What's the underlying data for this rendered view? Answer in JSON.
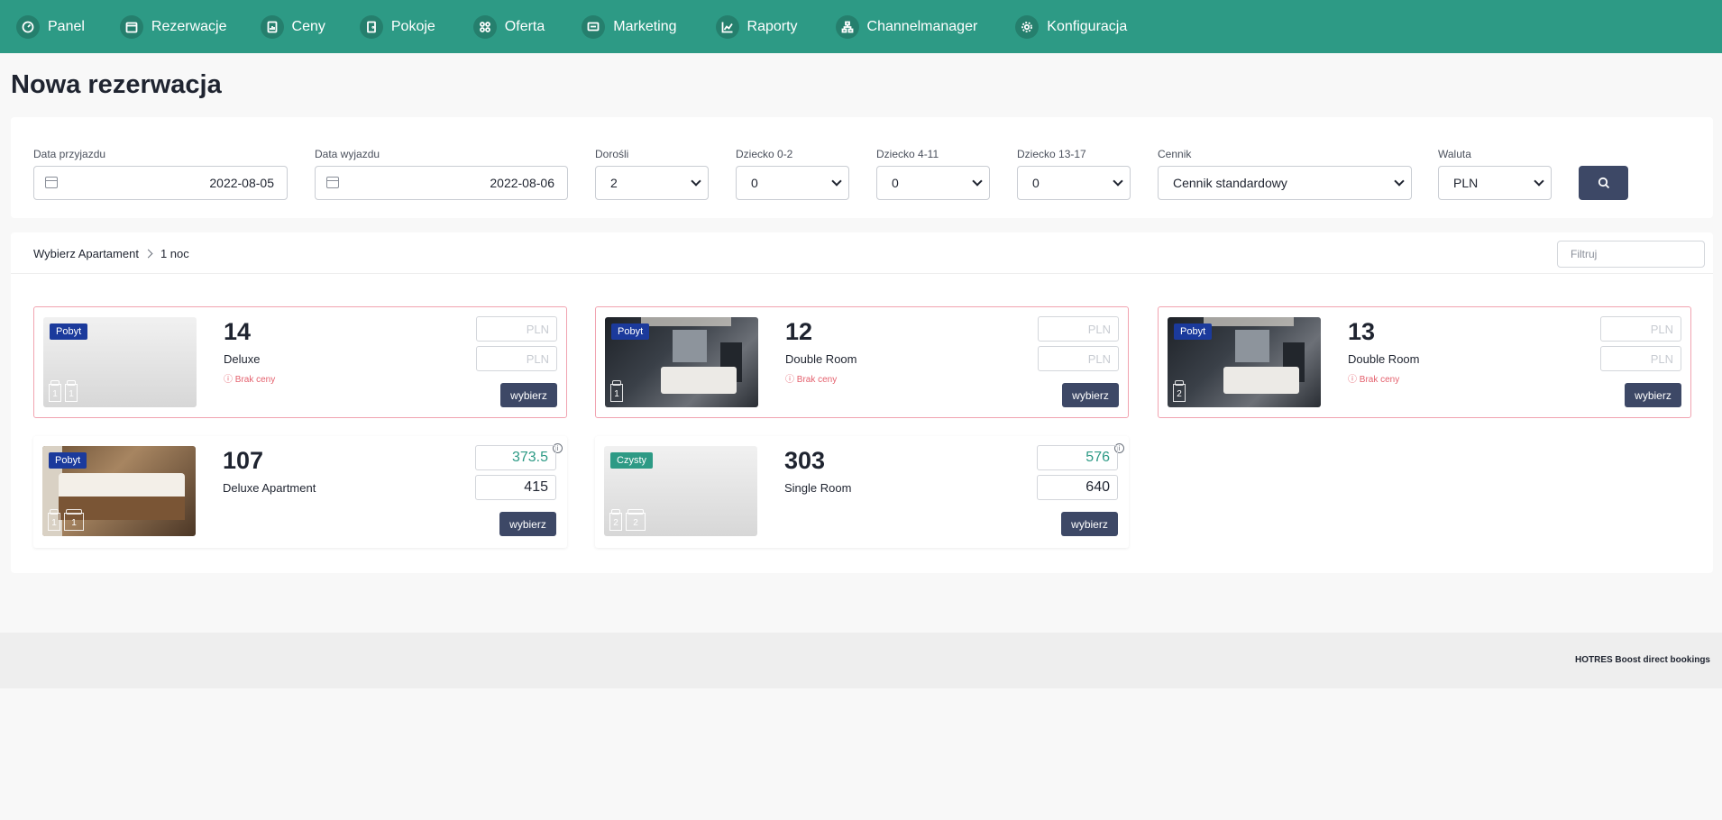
{
  "nav": {
    "items": [
      {
        "label": "Panel",
        "icon": "dashboard-icon"
      },
      {
        "label": "Rezerwacje",
        "icon": "calendar-icon"
      },
      {
        "label": "Ceny",
        "icon": "price-chart-icon"
      },
      {
        "label": "Pokoje",
        "icon": "door-icon"
      },
      {
        "label": "Oferta",
        "icon": "grid-icon"
      },
      {
        "label": "Marketing",
        "icon": "message-icon"
      },
      {
        "label": "Raporty",
        "icon": "line-chart-icon"
      },
      {
        "label": "Channelmanager",
        "icon": "network-icon"
      },
      {
        "label": "Konfiguracja",
        "icon": "gear-icon"
      }
    ],
    "bg_color": "#2d9a85"
  },
  "page": {
    "title": "Nowa rezerwacja"
  },
  "search": {
    "arrival": {
      "label": "Data przyjazdu",
      "value": "2022-08-05"
    },
    "departure": {
      "label": "Data wyjazdu",
      "value": "2022-08-06"
    },
    "adults": {
      "label": "Dorośli",
      "value": "2"
    },
    "child_0_2": {
      "label": "Dziecko 0-2",
      "value": "0"
    },
    "child_4_11": {
      "label": "Dziecko 4-11",
      "value": "0"
    },
    "child_13_17": {
      "label": "Dziecko 13-17",
      "value": "0"
    },
    "pricelist": {
      "label": "Cennik",
      "value": "Cennik standardowy"
    },
    "currency": {
      "label": "Waluta",
      "value": "PLN"
    },
    "search_icon": "search-icon"
  },
  "results": {
    "breadcrumb": {
      "step": "Wybierz Apartament",
      "nights": "1 noc"
    },
    "filter_placeholder": "Filtruj",
    "rooms": [
      {
        "number": "14",
        "type": "Deluxe",
        "status": "Pobyt",
        "no_price": "ⓘ Brak ceny",
        "price_top": "PLN",
        "price_bottom": "PLN",
        "beds": [
          "1",
          "1"
        ],
        "button": "wybierz"
      },
      {
        "number": "12",
        "type": "Double Room",
        "status": "Pobyt",
        "no_price": "ⓘ Brak ceny",
        "price_top": "PLN",
        "price_bottom": "PLN",
        "beds": [
          "1"
        ],
        "button": "wybierz"
      },
      {
        "number": "13",
        "type": "Double Room",
        "status": "Pobyt",
        "no_price": "ⓘ Brak ceny",
        "price_top": "PLN",
        "price_bottom": "PLN",
        "beds": [
          "2"
        ],
        "button": "wybierz"
      },
      {
        "number": "107",
        "type": "Deluxe Apartment",
        "status": "Pobyt",
        "price_top": "373.5",
        "price_bottom": "415",
        "beds": [
          "1",
          "1"
        ],
        "button": "wybierz"
      },
      {
        "number": "303",
        "type": "Single Room",
        "status": "Czysty",
        "price_top": "576",
        "price_bottom": "640",
        "beds": [
          "2",
          "2"
        ],
        "button": "wybierz"
      }
    ]
  },
  "colors": {
    "accent": "#2d9a85",
    "button": "#3d4866",
    "status_pobyt": "#1b3a9c",
    "warning_border": "#f1a3b0",
    "error_text": "#e4606d"
  },
  "footer": {
    "text": "HOTRES Boost direct bookings"
  }
}
